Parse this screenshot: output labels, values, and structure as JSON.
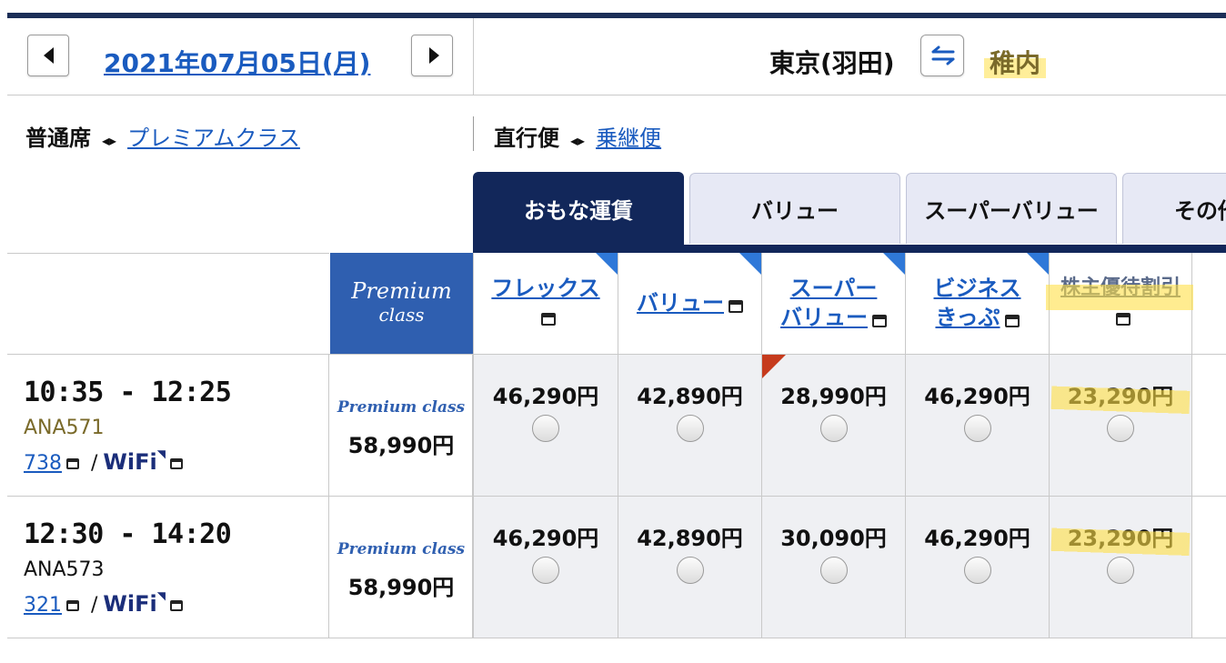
{
  "header": {
    "date": "2021年07月05日(月)",
    "origin": "東京(羽田)",
    "destination": "稚内"
  },
  "options": {
    "seat_current": "普通席",
    "seat_alt": "プレミアムクラス",
    "route_current": "直行便",
    "route_alt": "乗継便",
    "toggle_glyph": "◂▸"
  },
  "tabs": [
    {
      "label": "おもな運賃",
      "active": true
    },
    {
      "label": "バリュー",
      "active": false
    },
    {
      "label": "スーパーバリュー",
      "active": false
    },
    {
      "label": "その他",
      "active": false
    }
  ],
  "premium_header": {
    "line1": "Premium",
    "line2": "class"
  },
  "fare_columns": [
    {
      "line1": "フレックス",
      "line2": ""
    },
    {
      "line1": "バリュー",
      "line2": ""
    },
    {
      "line1": "スーパー",
      "line2": "バリュー"
    },
    {
      "line1": "ビジネス",
      "line2": "きっぷ"
    },
    {
      "line1": "株主優待割引",
      "line2": ""
    }
  ],
  "flights": [
    {
      "time": "10:35 - 12:25",
      "flight_no": "ANA571",
      "aircraft": "738",
      "wifi_label": "WiFi",
      "premium_label": "Premium class",
      "premium_price": "58,990円",
      "fares": [
        "46,290円",
        "42,890円",
        "28,990円",
        "46,290円",
        "23,290円"
      ]
    },
    {
      "time": "12:30 - 14:20",
      "flight_no": "ANA573",
      "aircraft": "321",
      "wifi_label": "WiFi",
      "premium_label": "Premium class",
      "premium_price": "58,990円",
      "fares": [
        "46,290円",
        "42,890円",
        "30,090円",
        "46,290円",
        "23,290円"
      ]
    }
  ],
  "colors": {
    "navy": "#12275a",
    "link_blue": "#1a5bbf",
    "premium_blue": "#2f5fb0",
    "highlight_yellow": "#ffe046",
    "flag_red": "#c63b1d"
  }
}
